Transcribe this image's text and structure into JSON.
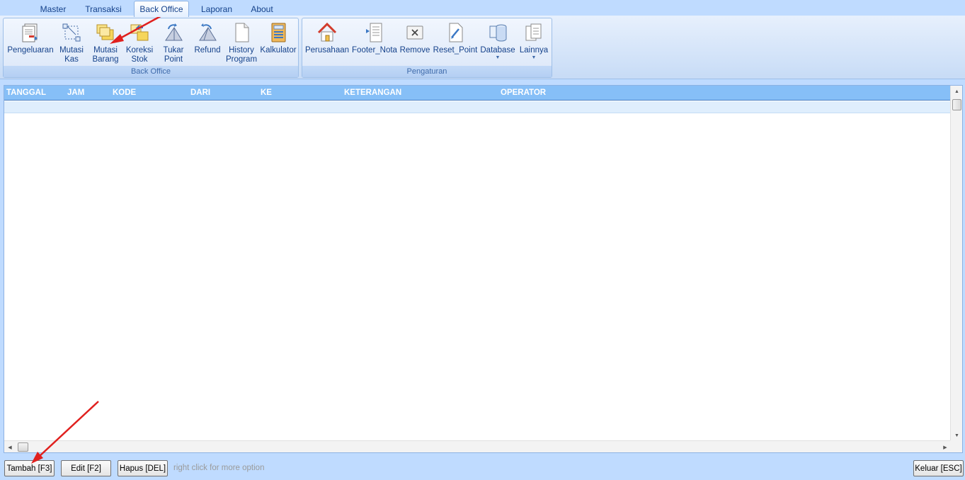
{
  "ribbon": {
    "tabs": [
      {
        "label": "Master"
      },
      {
        "label": "Transaksi"
      },
      {
        "label": "Back Office",
        "active": true
      },
      {
        "label": "Laporan"
      },
      {
        "label": "About"
      }
    ],
    "groups": {
      "back_office": {
        "label": "Back Office",
        "buttons": [
          {
            "label": "Pengeluaran",
            "icon": "expense-report-icon"
          },
          {
            "label": "Mutasi\nKas",
            "icon": "cash-mutation-icon"
          },
          {
            "label": "Mutasi\nBarang",
            "icon": "item-mutation-icon"
          },
          {
            "label": "Koreksi\nStok",
            "icon": "stock-correction-icon"
          },
          {
            "label": "Tukar\nPoint",
            "icon": "exchange-point-icon"
          },
          {
            "label": "Refund",
            "icon": "refund-icon"
          },
          {
            "label": "History\nProgram",
            "icon": "document-icon"
          },
          {
            "label": "Kalkulator",
            "icon": "calculator-icon"
          }
        ]
      },
      "pengaturan": {
        "label": "Pengaturan",
        "buttons": [
          {
            "label": "Perusahaan",
            "icon": "house-icon"
          },
          {
            "label": "Footer_Nota",
            "icon": "receipt-footer-icon"
          },
          {
            "label": "Remove",
            "icon": "remove-icon"
          },
          {
            "label": "Reset_Point",
            "icon": "reset-point-icon"
          },
          {
            "label": "Database",
            "icon": "database-icon",
            "dropdown": true
          },
          {
            "label": "Lainnya",
            "icon": "copy-documents-icon",
            "dropdown": true
          }
        ]
      }
    }
  },
  "grid": {
    "columns": [
      "TANGGAL",
      "JAM",
      "KODE",
      "DARI",
      "KE",
      "KETERANGAN",
      "OPERATOR"
    ],
    "rows": []
  },
  "footer": {
    "add_label": "Tambah [F3]",
    "edit_label": "Edit [F2]",
    "delete_label": "Hapus [DEL]",
    "hint": "right click for more option",
    "exit_label": "Keluar [ESC]"
  },
  "colors": {
    "header_bg": "#86bff7",
    "row_bg": "#dfeefd",
    "annotation_arrow": "#e0201e"
  }
}
